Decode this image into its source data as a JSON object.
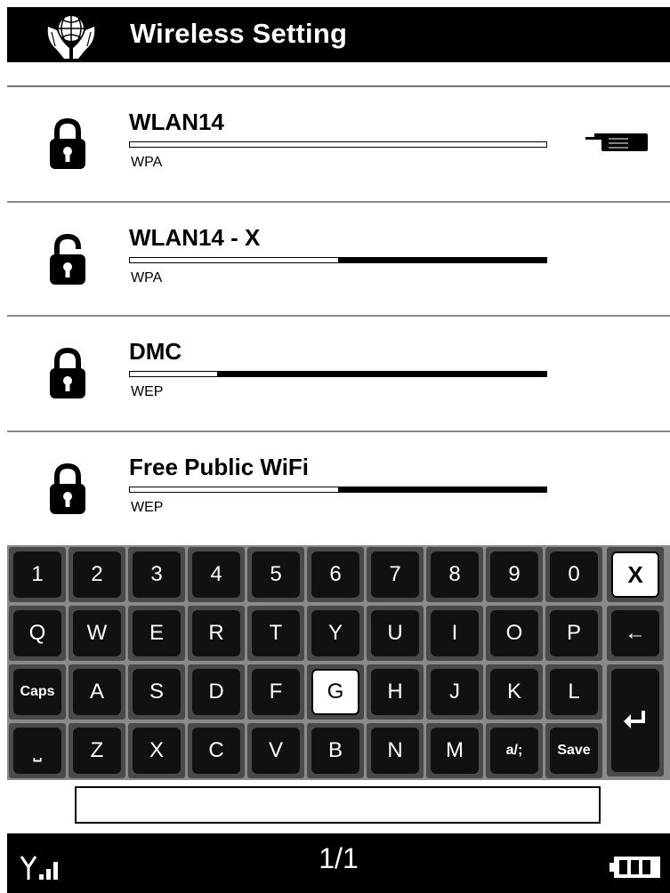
{
  "header": {
    "title": "Wireless Setting",
    "logo_icon": "globe-in-hands-icon"
  },
  "networks": [
    {
      "name": "WLAN14",
      "security": "WPA",
      "signal": 0.0,
      "lock": "locked",
      "selected": true
    },
    {
      "name": "WLAN14 - X",
      "security": "WPA",
      "signal": 0.5,
      "lock": "unlocked",
      "selected": false
    },
    {
      "name": "DMC",
      "security": "WEP",
      "signal": 0.79,
      "lock": "locked",
      "selected": false
    },
    {
      "name": "Free Public WiFi",
      "security": "WEP",
      "signal": 0.5,
      "lock": "locked",
      "selected": false
    }
  ],
  "keyboard": {
    "row1": [
      "1",
      "2",
      "3",
      "4",
      "5",
      "6",
      "7",
      "8",
      "9",
      "0",
      "X"
    ],
    "row2": [
      "Q",
      "W",
      "E",
      "R",
      "T",
      "Y",
      "U",
      "I",
      "O",
      "P",
      "←"
    ],
    "row3": [
      "Caps",
      "A",
      "S",
      "D",
      "F",
      "G",
      "H",
      "J",
      "K",
      "L"
    ],
    "row4": [
      "⎵",
      "Z",
      "X",
      "C",
      "V",
      "B",
      "N",
      "M",
      "a/;",
      "Save"
    ],
    "enter_icon": "enter-icon",
    "selected_key": "G"
  },
  "input": {
    "value": "",
    "placeholder": ""
  },
  "footer": {
    "page": "1/1",
    "signal_icon": "signal-strength-icon",
    "battery_icon": "battery-icon"
  },
  "colors": {
    "header_bg": "#000000",
    "keyboard_bg": "#8a8a8a",
    "key_bg": "#111111",
    "key_selected_bg": "#ffffff"
  }
}
